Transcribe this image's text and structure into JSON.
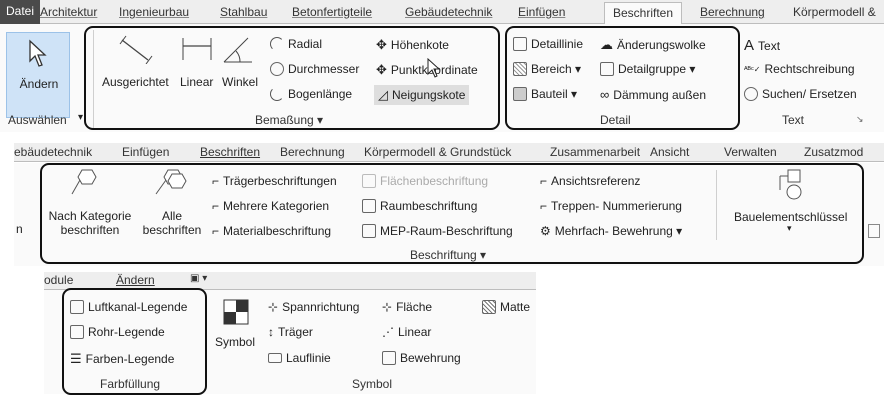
{
  "top": {
    "tabs": [
      "Datei",
      "Architektur",
      "Ingenieurbau",
      "Stahlbau",
      "Betonfertigteile",
      "Gebäudetechnik",
      "Einfügen",
      "Beschriften",
      "Berechnung",
      "Körpermodell &"
    ],
    "select": {
      "modify_label": "Ändern",
      "panel_title": "Auswählen",
      "arrow": "▾"
    },
    "dimension": {
      "tools": [
        "Ausgerichtet",
        "Linear",
        "Winkel"
      ],
      "small": [
        "Radial",
        "Durchmesser",
        "Bogenlänge"
      ],
      "spot": [
        "Höhenkote",
        "Punktkoordinate",
        "Neigungskote"
      ],
      "panel_title": "Bemaßung ▾"
    },
    "detail": {
      "col1": [
        "Detaillinie",
        "Bereich ▾",
        "Bauteil ▾"
      ],
      "col2": [
        "Änderungswolke",
        "Detailgruppe ▾",
        "Dämmung außen"
      ],
      "panel_title": "Detail"
    },
    "text": {
      "items": [
        "Text",
        "Rechtschreibung",
        "Suchen/ Ersetzen"
      ],
      "panel_title": "Text",
      "launcher": "↘"
    }
  },
  "middle": {
    "tabs": [
      "ebäudetechnik",
      "Einfügen",
      "Beschriften",
      "Berechnung",
      "Körpermodell & Grundstück",
      "Zusammenarbeit",
      "Ansicht",
      "Verwalten",
      "Zusatzmod"
    ],
    "large": [
      {
        "line1": "Nach Kategorie",
        "line2": "beschriften"
      },
      {
        "line1": "Alle",
        "line2": "beschriften"
      }
    ],
    "col1": [
      "Trägerbeschriftungen",
      "Mehrere Kategorien",
      "Materialbeschriftung"
    ],
    "col2": [
      "Flächenbeschriftung",
      "Raumbeschriftung",
      "MEP-Raum-Beschriftung"
    ],
    "col3": [
      "Ansichtsreferenz",
      "Treppen- Nummerierung",
      "Mehrfach- Bewehrung ▾"
    ],
    "keynote": {
      "label": "Bauelementschlüssel",
      "arrow": "▾"
    },
    "panel_title": "Beschriftung ▾",
    "left_fragment": "n"
  },
  "bottom": {
    "tabs": [
      "odule",
      "Ändern",
      "▣ ▾"
    ],
    "color_fill": {
      "items": [
        "Luftkanal-Legende",
        "Rohr-Legende",
        "Farben-Legende"
      ],
      "panel_title": "Farbfüllung"
    },
    "symbol": {
      "large_label": "Symbol",
      "col1": [
        "Spannrichtung",
        "Träger",
        "Lauflinie"
      ],
      "col2": [
        "Fläche",
        "Linear",
        "Bewehrung"
      ],
      "col3": [
        "Matte"
      ],
      "panel_title": "Symbol"
    }
  },
  "colors": {
    "highlight_box": "#111111",
    "ribbon_bg": "#fafafa",
    "tab_bg": "#eeeeee"
  }
}
